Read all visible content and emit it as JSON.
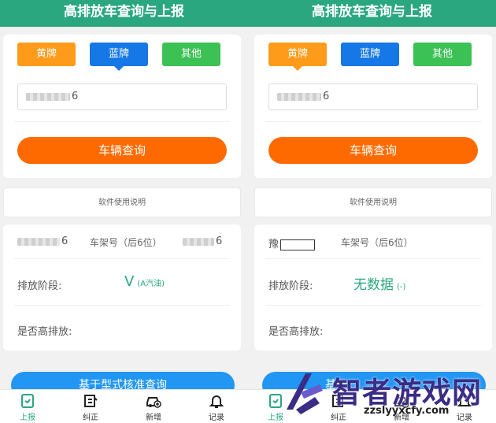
{
  "header": {
    "title": "高排放车查询与上报"
  },
  "plates": {
    "yellow": "黄牌",
    "blue": "蓝牌",
    "other": "其他"
  },
  "left": {
    "plate_suffix": "6",
    "query_label": "车辆查询",
    "manual_label": "软件使用说明",
    "result": {
      "plate_suffix": "6",
      "vin_label": "车架号（后6位）",
      "vin_suffix": "6",
      "stage_label": "排放阶段:",
      "stage_value": "V",
      "stage_note": "(A汽油)",
      "high_label": "是否高排放:"
    },
    "bottom_button": "基于型式核准查询"
  },
  "right": {
    "plate_suffix": "6",
    "query_label": "车辆查询",
    "manual_label": "软件使用说明",
    "result": {
      "plate_prefix": "豫",
      "vin_label": "车架号（后6位）",
      "stage_label": "排放阶段:",
      "stage_value": "无数据",
      "stage_note": "(-)",
      "high_label": "是否高排放:"
    },
    "bottom_button": "基于"
  },
  "tabs": [
    {
      "label": "上报",
      "icon": "report-icon"
    },
    {
      "label": "纠正",
      "icon": "edit-icon"
    },
    {
      "label": "新增",
      "icon": "add-car-icon"
    },
    {
      "label": "记录",
      "icon": "bell-icon"
    }
  ],
  "watermark": {
    "brand": "智者游戏网",
    "url": "zzslyyxcfy.com"
  },
  "colors": {
    "header": "#2aa77f",
    "yellow": "#ff9b1a",
    "blue": "#1677e6",
    "green": "#3cc254",
    "query": "#ff6a00",
    "bottom": "#2196f3"
  }
}
